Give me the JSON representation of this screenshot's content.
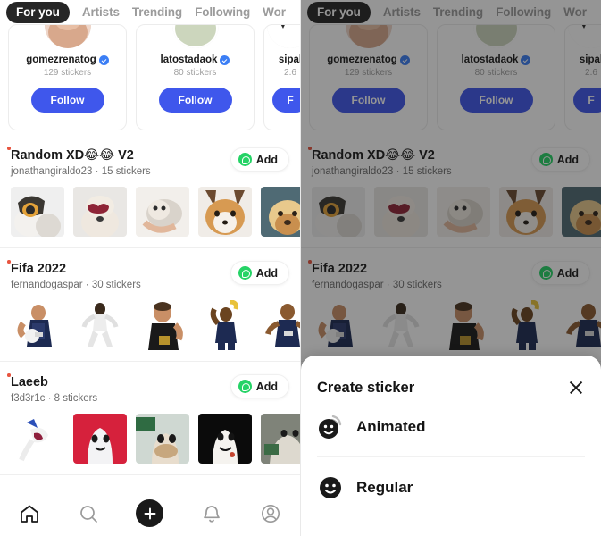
{
  "app": {
    "accent_blue": "#3f57ec",
    "whatsapp_green": "#25d366",
    "active_tab_bg": "#262626",
    "new_dot_color": "#e8543f"
  },
  "tabs": [
    {
      "label": "For you",
      "active": true
    },
    {
      "label": "Artists",
      "active": false
    },
    {
      "label": "Trending",
      "active": false
    },
    {
      "label": "Following",
      "active": false
    },
    {
      "label": "Wor",
      "active": false
    }
  ],
  "creator_cards": [
    {
      "name": "gomezrenatog",
      "verified": true,
      "stickers": "129 stickers",
      "follow_label": "Follow"
    },
    {
      "name": "latostadaok",
      "verified": true,
      "stickers": "80 stickers",
      "follow_label": "Follow"
    },
    {
      "name": "sipal",
      "verified": false,
      "stickers": "2.6",
      "follow_label": "F"
    }
  ],
  "packs": [
    {
      "title": "Random XD😂😂 V2",
      "author": "jonathangiraldo23",
      "count": "15 stickers",
      "separator": "·",
      "add_label": "Add",
      "thumb_count": 5
    },
    {
      "title": "Fifa 2022",
      "author": "fernandogaspar",
      "count": "30 stickers",
      "separator": "·",
      "add_label": "Add",
      "thumb_count": 5
    },
    {
      "title": "Laeeb",
      "author": "f3d3r1c",
      "count": "8 stickers",
      "separator": "·",
      "add_label": "Add",
      "thumb_count": 5
    }
  ],
  "bottom_nav": [
    {
      "icon": "home-icon",
      "active": true
    },
    {
      "icon": "search-icon",
      "active": false
    },
    {
      "icon": "plus-icon",
      "active": false
    },
    {
      "icon": "bell-icon",
      "active": false
    },
    {
      "icon": "profile-icon",
      "active": false
    }
  ],
  "sheet": {
    "title": "Create sticker",
    "close_icon": "close-icon",
    "options": [
      {
        "label": "Animated",
        "icon": "animated-smiley-icon"
      },
      {
        "label": "Regular",
        "icon": "smiley-icon"
      }
    ]
  }
}
